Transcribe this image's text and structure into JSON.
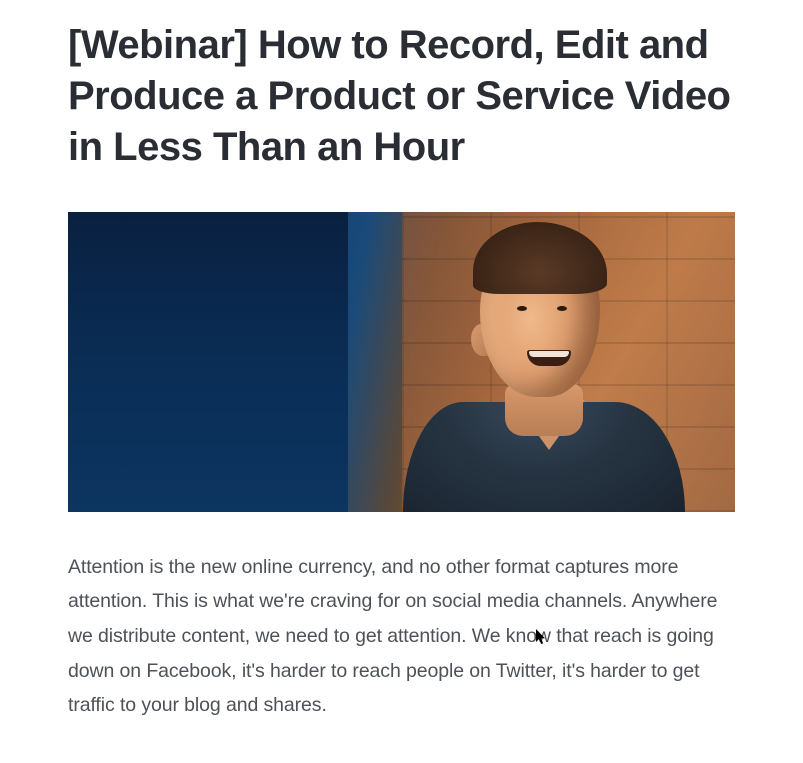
{
  "article": {
    "title": "[Webinar] How to Record, Edit and Produce a Product or Service Video in Less Than an Hour",
    "hero_alt": "Smiling man in dark v-neck shirt against brick wall and blue gradient backdrop",
    "body": "Attention is the new online currency, and no other format captures more attention. This is what we're craving for on social media channels. Anywhere we distribute content, we need to get attention. We know that reach is going down on Facebook, it's harder to reach people on Twitter, it's harder to get traffic to your blog and shares."
  }
}
